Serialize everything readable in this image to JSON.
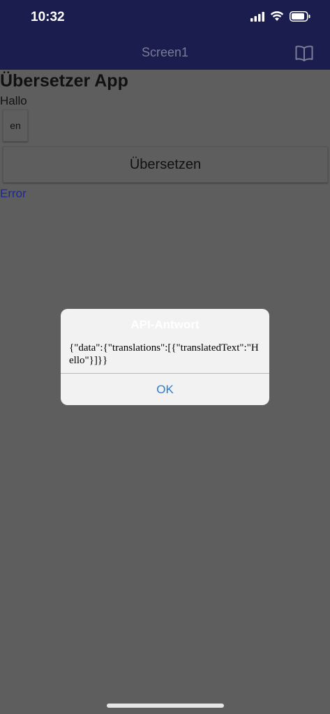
{
  "status_bar": {
    "time": "10:32",
    "icons": [
      "signal-icon",
      "wifi-icon",
      "battery-icon"
    ]
  },
  "header": {
    "title": "Screen1",
    "icon": "book-icon"
  },
  "content": {
    "app_title": "Übersetzer App",
    "input_text": "Hallo",
    "lang_button": "en",
    "translate_button": "Übersetzen",
    "status_text": "Error"
  },
  "dialog": {
    "title": "API-Antwort",
    "message": "{\"data\":{\"translations\":[{\"translatedText\":\"Hello\"}]}}",
    "ok_label": "OK"
  },
  "colors": {
    "header_bg": "#1a1d4d",
    "overlay_bg": "#5e5e5e",
    "dialog_bg": "#f2f2f2",
    "link_blue": "#2a7bd8",
    "error_blue": "#1f2a8a"
  }
}
